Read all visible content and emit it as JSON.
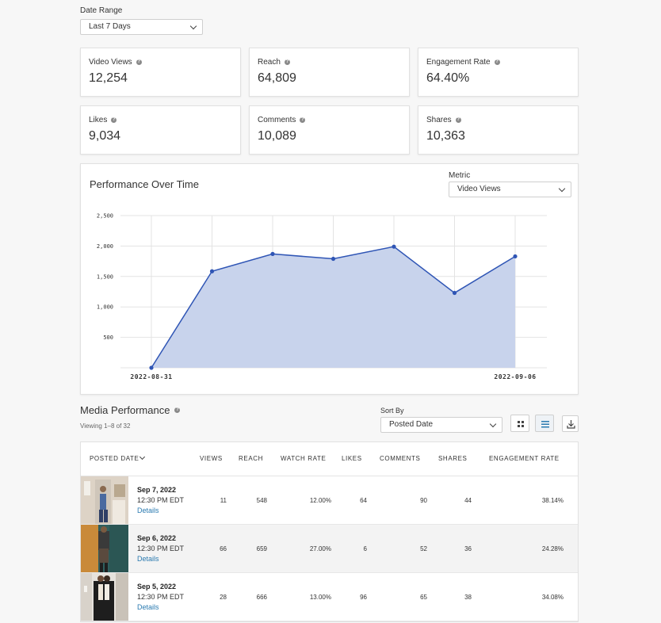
{
  "filters": {
    "date_range_label": "Date Range",
    "date_range_value": "Last 7 Days"
  },
  "stats": [
    {
      "label": "Video Views",
      "value": "12,254"
    },
    {
      "label": "Reach",
      "value": "64,809"
    },
    {
      "label": "Engagement Rate",
      "value": "64.40%"
    },
    {
      "label": "Likes",
      "value": "9,034"
    },
    {
      "label": "Comments",
      "value": "10,089"
    },
    {
      "label": "Shares",
      "value": "10,363"
    }
  ],
  "performance": {
    "title": "Performance Over Time",
    "metric_label": "Metric",
    "metric_value": "Video Views"
  },
  "chart_data": {
    "type": "area",
    "title": "Performance Over Time",
    "x": [
      "2022-08-31",
      "2022-09-01",
      "2022-09-02",
      "2022-09-03",
      "2022-09-04",
      "2022-09-05",
      "2022-09-06"
    ],
    "x_tick_labels": [
      "2022-08-31",
      "2022-09-06"
    ],
    "series": [
      {
        "values": [
          0,
          1585,
          1870,
          1790,
          1990,
          1230,
          1830
        ]
      }
    ],
    "y_ticks": [
      "2,500",
      "2,000",
      "1,500",
      "1,000",
      "500"
    ],
    "ylim": [
      0,
      2500
    ],
    "grid": true,
    "colors": {
      "line": "#2f55b5",
      "fill": "#c8d3ec"
    }
  },
  "media": {
    "title": "Media Performance",
    "viewing": "Viewing 1–8 of 32",
    "sort_label": "Sort By",
    "sort_value": "Posted Date",
    "columns": [
      "POSTED DATE",
      "VIEWS",
      "REACH",
      "WATCH RATE",
      "LIKES",
      "COMMENTS",
      "SHARES",
      "ENGAGEMENT RATE"
    ],
    "rows": [
      {
        "date": "Sep 7, 2022",
        "time": "12:30 PM EDT",
        "details": "Details",
        "views": "11",
        "reach": "548",
        "watch_rate": "12.00%",
        "likes": "64",
        "comments": "90",
        "shares": "44",
        "engagement": "38.14%"
      },
      {
        "date": "Sep 6, 2022",
        "time": "12:30 PM EDT",
        "details": "Details",
        "views": "66",
        "reach": "659",
        "watch_rate": "27.00%",
        "likes": "6",
        "comments": "52",
        "shares": "36",
        "engagement": "24.28%"
      },
      {
        "date": "Sep 5, 2022",
        "time": "12:30 PM EDT",
        "details": "Details",
        "views": "28",
        "reach": "666",
        "watch_rate": "13.00%",
        "likes": "96",
        "comments": "65",
        "shares": "38",
        "engagement": "34.08%"
      }
    ]
  }
}
